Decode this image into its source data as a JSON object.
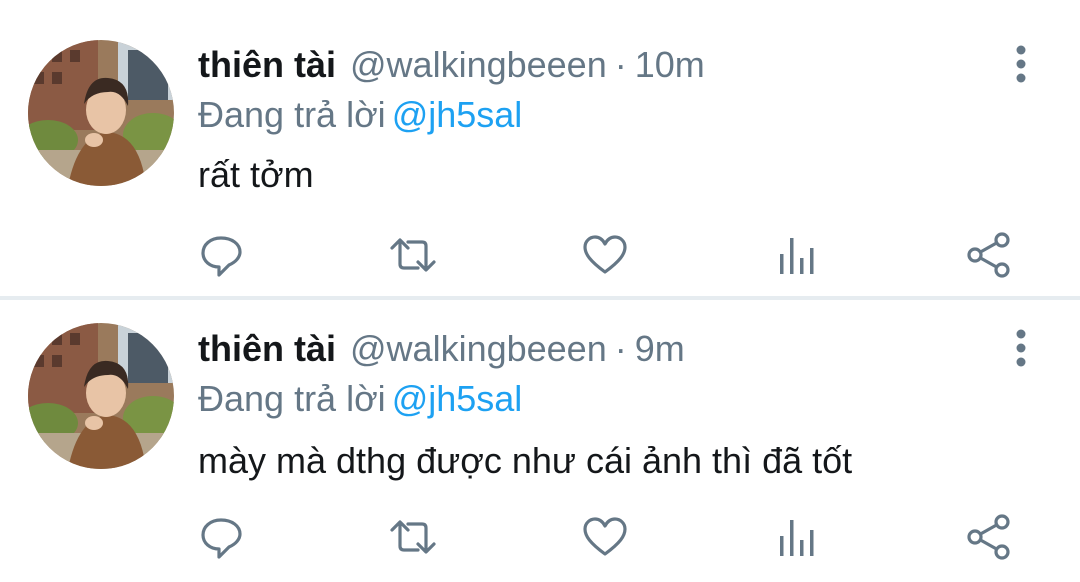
{
  "tweets": [
    {
      "name": "thiên tài",
      "handle": "@walkingbeeen",
      "separator": "·",
      "time": "10m",
      "reply_prefix": "Đang trả lời",
      "reply_to": "@jh5sal",
      "text": "rất tởm",
      "actions": [
        "reply-icon",
        "retweet-icon",
        "like-icon",
        "analytics-icon",
        "share-icon"
      ]
    },
    {
      "name": "thiên tài",
      "handle": "@walkingbeeen",
      "separator": "·",
      "time": "9m",
      "reply_prefix": "Đang trả lời",
      "reply_to": "@jh5sal",
      "text": "mày mà dthg được như cái ảnh thì đã tốt",
      "actions": [
        "reply-icon",
        "retweet-icon",
        "like-icon",
        "analytics-icon",
        "share-icon"
      ]
    }
  ],
  "colors": {
    "text": "#14171a",
    "muted": "#657786",
    "link": "#1da1f2",
    "divider": "#e6ecf0"
  }
}
